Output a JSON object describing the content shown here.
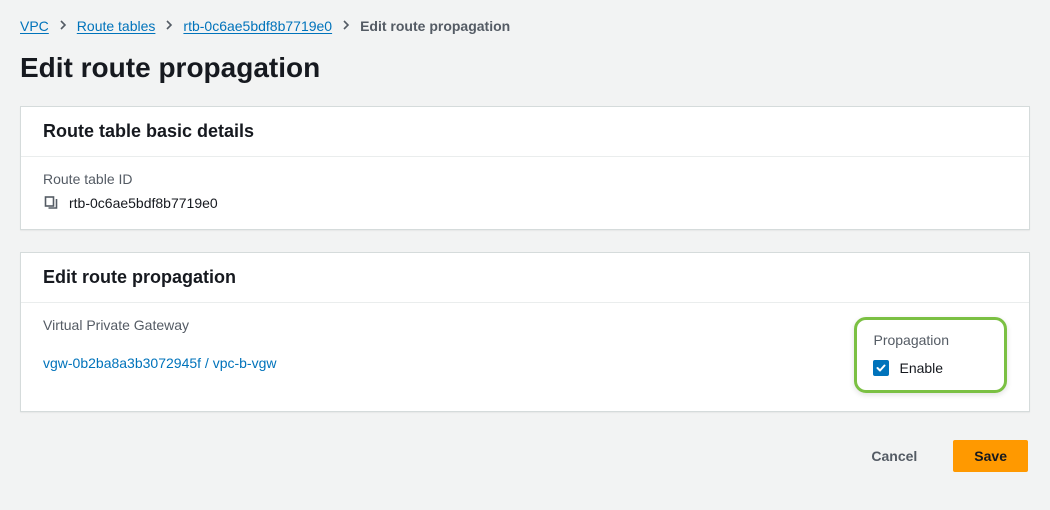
{
  "breadcrumb": {
    "items": [
      {
        "label": "VPC",
        "link": true
      },
      {
        "label": "Route tables",
        "link": true
      },
      {
        "label": "rtb-0c6ae5bdf8b7719e0",
        "link": true
      },
      {
        "label": "Edit route propagation",
        "link": false
      }
    ]
  },
  "page": {
    "title": "Edit route propagation"
  },
  "panel_basic_details": {
    "title": "Route table basic details",
    "route_table_id_label": "Route table ID",
    "route_table_id_value": "rtb-0c6ae5bdf8b7719e0"
  },
  "panel_propagation": {
    "title": "Edit route propagation",
    "vgw_label": "Virtual Private Gateway",
    "vgw_link": "vgw-0b2ba8a3b3072945f / vpc-b-vgw",
    "propagation_label": "Propagation",
    "enable_label": "Enable",
    "enable_checked": true
  },
  "actions": {
    "cancel": "Cancel",
    "save": "Save"
  }
}
